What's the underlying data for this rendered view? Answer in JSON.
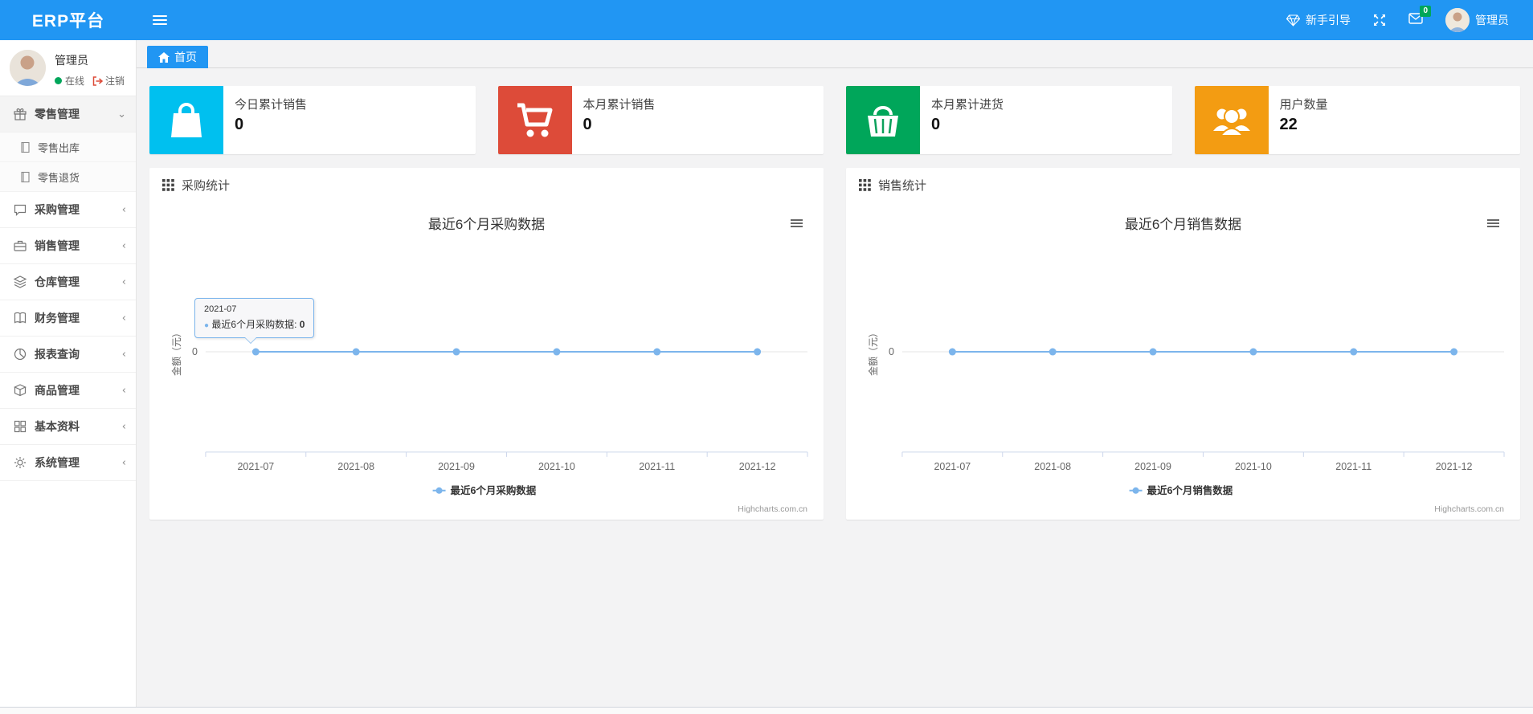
{
  "header": {
    "brand": "ERP平台",
    "guide_label": "新手引导",
    "mail_badge": "0",
    "user_name": "管理员"
  },
  "sidebar": {
    "user": {
      "name": "管理员",
      "status": "在线",
      "logout": "注销"
    },
    "items": [
      {
        "label": "零售管理",
        "icon": "gift-icon",
        "expanded": true
      },
      {
        "label": "采购管理",
        "icon": "comment-icon"
      },
      {
        "label": "销售管理",
        "icon": "briefcase-icon"
      },
      {
        "label": "仓库管理",
        "icon": "layers-icon"
      },
      {
        "label": "财务管理",
        "icon": "book-icon"
      },
      {
        "label": "报表查询",
        "icon": "pie-chart-icon"
      },
      {
        "label": "商品管理",
        "icon": "box-icon"
      },
      {
        "label": "基本资料",
        "icon": "grid-icon"
      },
      {
        "label": "系统管理",
        "icon": "gear-icon"
      }
    ],
    "retail_children": [
      {
        "label": "零售出库",
        "icon": "file-icon"
      },
      {
        "label": "零售退货",
        "icon": "file-icon"
      }
    ]
  },
  "breadcrumb": {
    "home": "首页"
  },
  "stat_cards": [
    {
      "label": "今日累计销售",
      "value": "0",
      "color": "#00c0ef",
      "icon": "shopping-bag-icon"
    },
    {
      "label": "本月累计销售",
      "value": "0",
      "color": "#dd4b39",
      "icon": "cart-icon"
    },
    {
      "label": "本月累计进货",
      "value": "0",
      "color": "#00a65a",
      "icon": "basket-icon"
    },
    {
      "label": "用户数量",
      "value": "22",
      "color": "#f39c12",
      "icon": "users-icon"
    }
  ],
  "panels": [
    {
      "title": "采购统计"
    },
    {
      "title": "销售统计"
    }
  ],
  "chart_data": [
    {
      "type": "line",
      "title": "最近6个月采购数据",
      "categories": [
        "2021-07",
        "2021-08",
        "2021-09",
        "2021-10",
        "2021-11",
        "2021-12"
      ],
      "series": [
        {
          "name": "最近6个月采购数据",
          "values": [
            0,
            0,
            0,
            0,
            0,
            0
          ]
        }
      ],
      "xlabel": "",
      "ylabel": "金额（元）",
      "yticks": [
        "0"
      ],
      "ylim": [
        0,
        1
      ],
      "grid": "minimal",
      "legend_position": "bottom",
      "line_color": "#7cb5ec",
      "credits": "Highcharts.com.cn",
      "tooltip": {
        "visible": true,
        "title": "2021-07",
        "label_with_colon": "最近6个月采购数据: ",
        "value": "0"
      }
    },
    {
      "type": "line",
      "title": "最近6个月销售数据",
      "categories": [
        "2021-07",
        "2021-08",
        "2021-09",
        "2021-10",
        "2021-11",
        "2021-12"
      ],
      "series": [
        {
          "name": "最近6个月销售数据",
          "values": [
            0,
            0,
            0,
            0,
            0,
            0
          ]
        }
      ],
      "xlabel": "",
      "ylabel": "金额（元）",
      "yticks": [
        "0"
      ],
      "ylim": [
        0,
        1
      ],
      "grid": "minimal",
      "legend_position": "bottom",
      "line_color": "#7cb5ec",
      "credits": "Highcharts.com.cn",
      "tooltip": {
        "visible": false
      }
    }
  ],
  "colors": {
    "navbar": "#2196f3",
    "line": "#7cb5ec",
    "badge_green": "#00a65a"
  }
}
